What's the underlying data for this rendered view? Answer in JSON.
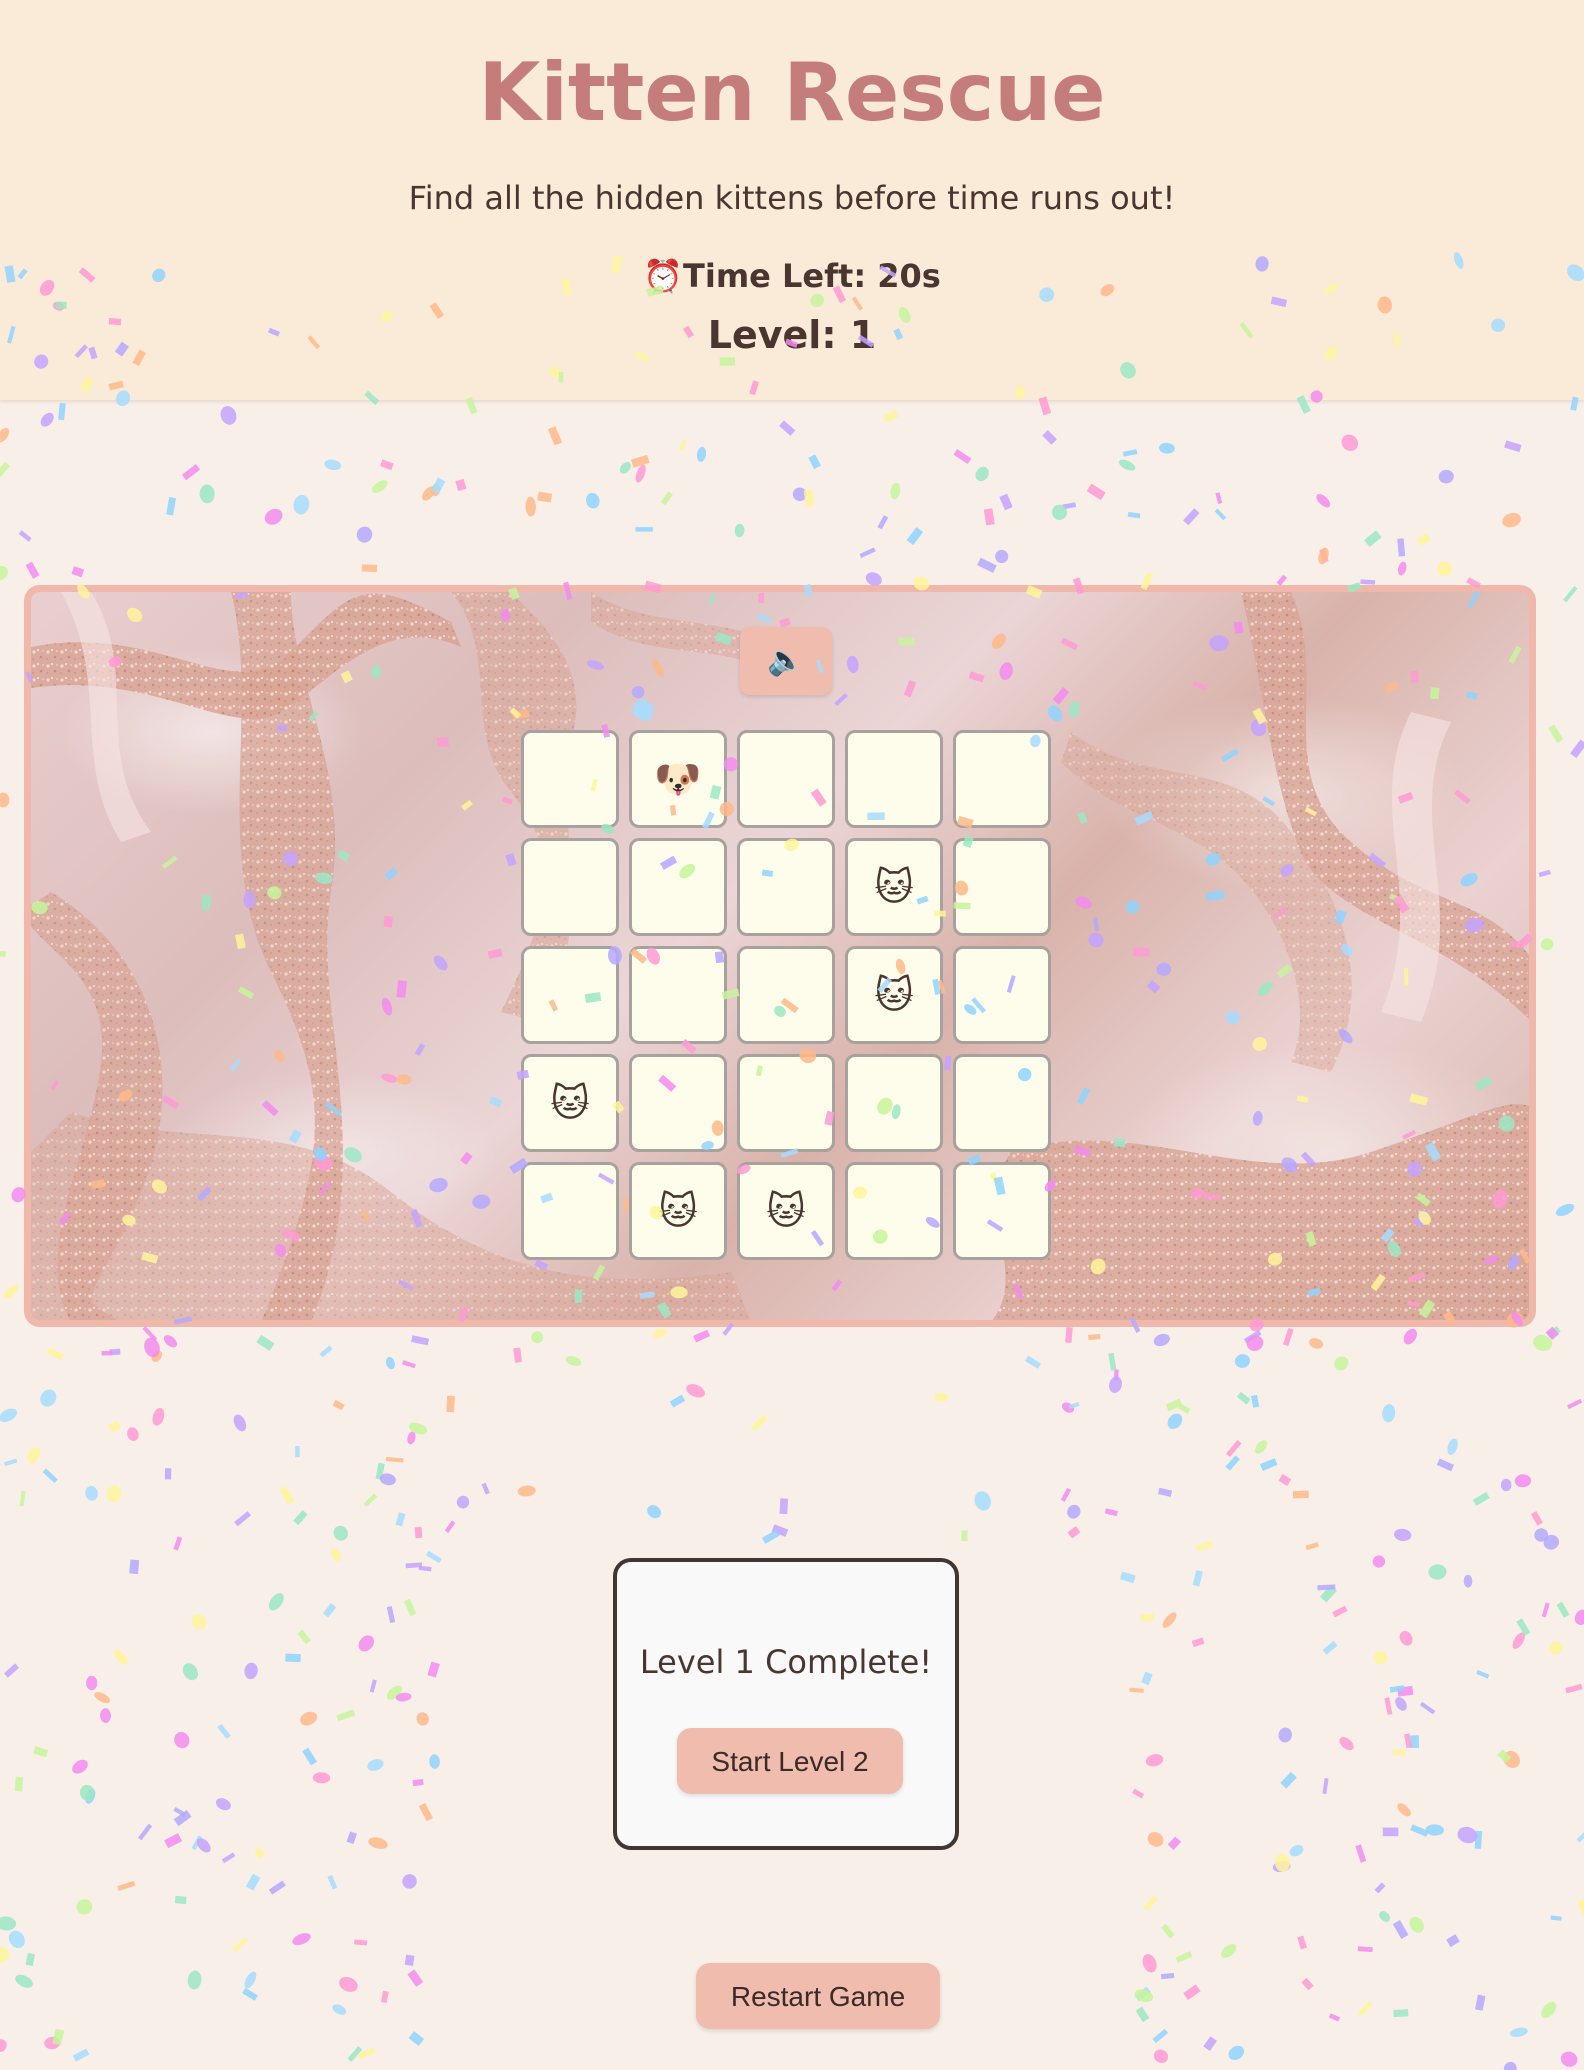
{
  "header": {
    "title": "Kitten Rescue",
    "subtitle": "Find all the hidden kittens before time runs out!",
    "timer_icon": "⏰",
    "timer_label": "Time Left:",
    "timer_value": "20s",
    "level_label": "Level:",
    "level_value": "1"
  },
  "sound_button": {
    "icon": "🔈",
    "icon_name": "speaker-muted-icon"
  },
  "grid": {
    "rows": 5,
    "cols": 5,
    "cells": [
      "",
      "🐶",
      "",
      "",
      "",
      "",
      "",
      "",
      "🐱",
      "",
      "",
      "",
      "",
      "🐱",
      "",
      "🐱",
      "",
      "",
      "",
      "",
      "",
      "🐱",
      "🐱",
      "",
      ""
    ]
  },
  "modal": {
    "message": "Level 1 Complete!",
    "button_label": "Start Level 2"
  },
  "restart_button": {
    "label": "Restart Game"
  },
  "colors": {
    "title": "#c47d7a",
    "header_bg": "#faebd9",
    "page_bg": "#f8efe8",
    "button_bg": "#efbcae",
    "board_border": "#efb8aa",
    "cell_bg": "#fefdec"
  }
}
